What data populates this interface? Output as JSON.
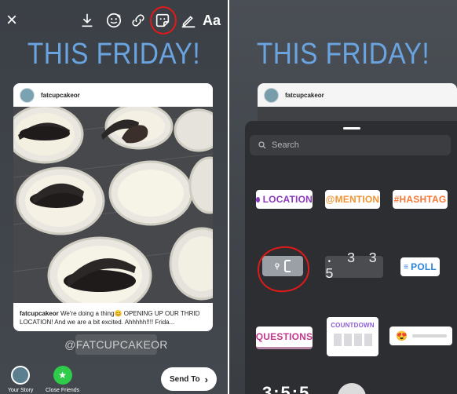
{
  "left_panel": {
    "toolbar": {
      "close": "×",
      "text_tool": "Aa"
    },
    "headline": "THIS FRIDAY!",
    "post": {
      "username": "fatcupcakeor",
      "caption_user": "fatcupcakeor",
      "caption_text": " We're doing a thing😊 OPENING UP OUR THRID LOCATION! And we are a bit excited. Ahhhhh!!!! Frida..."
    },
    "mention_tag": "@FATCUPCAKEOR",
    "bottom": {
      "your_story": "Your Story",
      "close_friends": "Close Friends",
      "send_to": "Send To"
    }
  },
  "right_panel": {
    "headline": "THIS FRIDAY!",
    "post": {
      "username": "fatcupcakeor"
    },
    "tray": {
      "search_placeholder": "Search",
      "stickers": {
        "location": "LOCATION",
        "mention": "@MENTION",
        "hashtag": "#HASHTAG",
        "countdown_digits": ". 3 3 5",
        "poll": "POLL",
        "questions": "QUESTIONS",
        "countdown": "COUNTDOWN"
      },
      "bottom_peek": "3:5:5"
    }
  },
  "colors": {
    "headline_blue": "#6aa4e0",
    "annotation_red": "#e01a1a",
    "tray_bg": "#2c2e31"
  }
}
